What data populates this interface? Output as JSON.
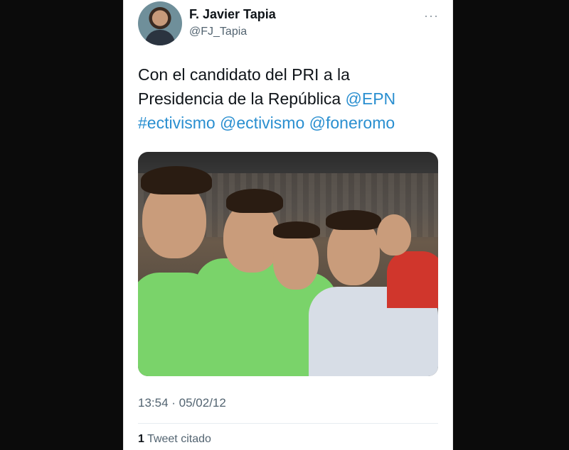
{
  "tweet": {
    "author_name": "F. Javier Tapia",
    "author_handle": "@FJ_Tapia",
    "more_icon": "···",
    "text_plain": "Con el candidato del PRI a la Presidencia de la República ",
    "mention_epn": "@EPN",
    "hashtag": "#ectivismo",
    "mention_ectivismo": "@ectivismo",
    "mention_foneromo": "@foneromo",
    "timestamp": "13:54 · 05/02/12",
    "quote_count": "1",
    "quote_label": " Tweet citado"
  },
  "colors": {
    "link": "#2a8fd0",
    "text": "#0f1419",
    "muted": "#536471"
  },
  "icons": {
    "more": "more-options-icon"
  }
}
